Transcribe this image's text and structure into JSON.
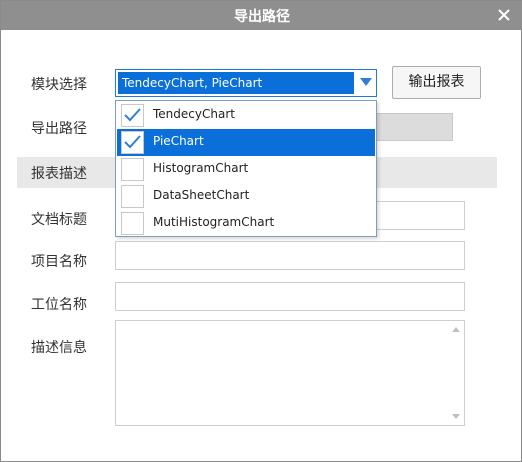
{
  "dialog": {
    "title": "导出路径"
  },
  "module": {
    "label": "模块选择",
    "selected_value": "TendecyChart, PieChart",
    "options": [
      {
        "label": "TendecyChart",
        "checked": true
      },
      {
        "label": "PieChart",
        "checked": true,
        "highlighted": true
      },
      {
        "label": "HistogramChart",
        "checked": false
      },
      {
        "label": "DataSheetChart",
        "checked": false
      },
      {
        "label": "MutiHistogramChart",
        "checked": false
      }
    ]
  },
  "export_button": {
    "label": "输出报表"
  },
  "export_path": {
    "label": "导出路径",
    "value": ""
  },
  "section": {
    "title": "报表描述"
  },
  "fields": {
    "doc_title": {
      "label": "文档标题",
      "value": ""
    },
    "project_name": {
      "label": "项目名称",
      "value": ""
    },
    "station_name": {
      "label": "工位名称",
      "value": ""
    },
    "description": {
      "label": "描述信息",
      "value": ""
    }
  },
  "colors": {
    "titlebar": "#8f8f8f",
    "accent": "#0a6fd8"
  },
  "icons": {
    "close": "close-icon",
    "check": "checkmark-icon",
    "dropdown": "chevron-down-icon"
  }
}
